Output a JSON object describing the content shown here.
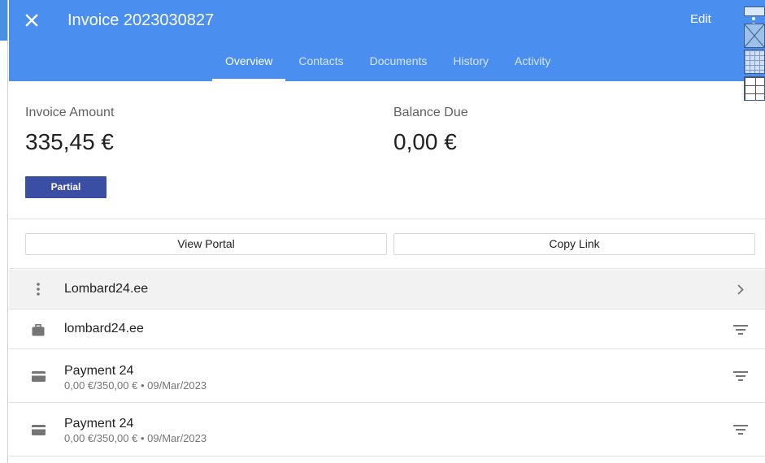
{
  "header": {
    "title": "Invoice 2023030827",
    "edit_label": "Edit"
  },
  "tabs": [
    {
      "label": "Overview",
      "active": true
    },
    {
      "label": "Contacts",
      "active": false
    },
    {
      "label": "Documents",
      "active": false
    },
    {
      "label": "History",
      "active": false
    },
    {
      "label": "Activity",
      "active": false
    }
  ],
  "summary": {
    "invoice_amount_label": "Invoice Amount",
    "invoice_amount": "335,45 €",
    "balance_due_label": "Balance Due",
    "balance_due": "0,00 €",
    "status_badge": "Partial"
  },
  "actions": {
    "view_portal": "View Portal",
    "copy_link": "Copy Link"
  },
  "list": [
    {
      "icon": "more-vert-icon",
      "title": "Lombard24.ee",
      "subtitle": "",
      "trailing_icon": "chevron-right-icon"
    },
    {
      "icon": "briefcase-icon",
      "title": "lombard24.ee",
      "subtitle": "",
      "trailing_icon": "filter-icon"
    },
    {
      "icon": "credit-card-icon",
      "title": "Payment 24",
      "subtitle": "0,00 €/350,00 € • 09/Mar/2023",
      "trailing_icon": "filter-icon"
    },
    {
      "icon": "credit-card-icon",
      "title": "Payment 24",
      "subtitle": "0,00 €/350,00 € • 09/Mar/2023",
      "trailing_icon": "filter-icon"
    }
  ],
  "colors": {
    "app_bar": "#4a8ff0",
    "badge": "#3a4fa3"
  }
}
